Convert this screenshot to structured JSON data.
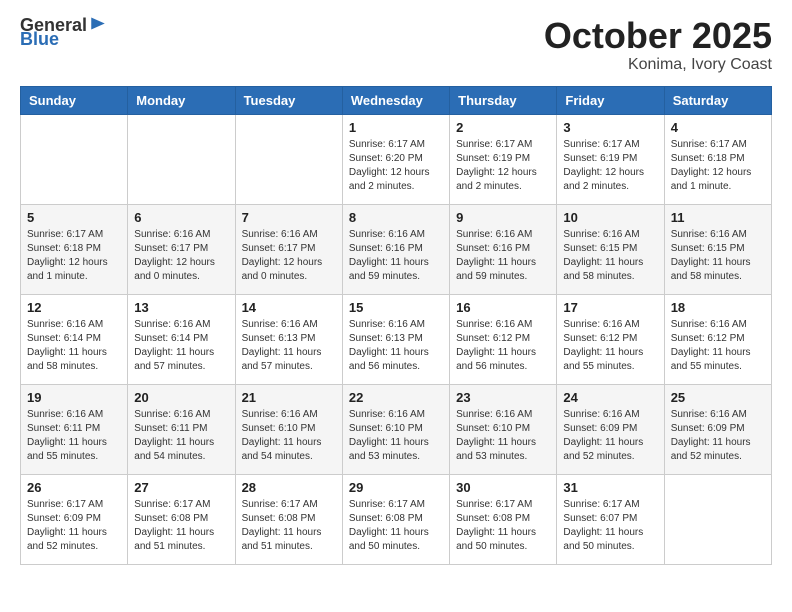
{
  "header": {
    "logo_general": "General",
    "logo_blue": "Blue",
    "month_title": "October 2025",
    "location": "Konima, Ivory Coast"
  },
  "weekdays": [
    "Sunday",
    "Monday",
    "Tuesday",
    "Wednesday",
    "Thursday",
    "Friday",
    "Saturday"
  ],
  "weeks": [
    [
      {
        "day": "",
        "sunrise": "",
        "sunset": "",
        "daylight": ""
      },
      {
        "day": "",
        "sunrise": "",
        "sunset": "",
        "daylight": ""
      },
      {
        "day": "",
        "sunrise": "",
        "sunset": "",
        "daylight": ""
      },
      {
        "day": "1",
        "sunrise": "Sunrise: 6:17 AM",
        "sunset": "Sunset: 6:20 PM",
        "daylight": "Daylight: 12 hours and 2 minutes."
      },
      {
        "day": "2",
        "sunrise": "Sunrise: 6:17 AM",
        "sunset": "Sunset: 6:19 PM",
        "daylight": "Daylight: 12 hours and 2 minutes."
      },
      {
        "day": "3",
        "sunrise": "Sunrise: 6:17 AM",
        "sunset": "Sunset: 6:19 PM",
        "daylight": "Daylight: 12 hours and 2 minutes."
      },
      {
        "day": "4",
        "sunrise": "Sunrise: 6:17 AM",
        "sunset": "Sunset: 6:18 PM",
        "daylight": "Daylight: 12 hours and 1 minute."
      }
    ],
    [
      {
        "day": "5",
        "sunrise": "Sunrise: 6:17 AM",
        "sunset": "Sunset: 6:18 PM",
        "daylight": "Daylight: 12 hours and 1 minute."
      },
      {
        "day": "6",
        "sunrise": "Sunrise: 6:16 AM",
        "sunset": "Sunset: 6:17 PM",
        "daylight": "Daylight: 12 hours and 0 minutes."
      },
      {
        "day": "7",
        "sunrise": "Sunrise: 6:16 AM",
        "sunset": "Sunset: 6:17 PM",
        "daylight": "Daylight: 12 hours and 0 minutes."
      },
      {
        "day": "8",
        "sunrise": "Sunrise: 6:16 AM",
        "sunset": "Sunset: 6:16 PM",
        "daylight": "Daylight: 11 hours and 59 minutes."
      },
      {
        "day": "9",
        "sunrise": "Sunrise: 6:16 AM",
        "sunset": "Sunset: 6:16 PM",
        "daylight": "Daylight: 11 hours and 59 minutes."
      },
      {
        "day": "10",
        "sunrise": "Sunrise: 6:16 AM",
        "sunset": "Sunset: 6:15 PM",
        "daylight": "Daylight: 11 hours and 58 minutes."
      },
      {
        "day": "11",
        "sunrise": "Sunrise: 6:16 AM",
        "sunset": "Sunset: 6:15 PM",
        "daylight": "Daylight: 11 hours and 58 minutes."
      }
    ],
    [
      {
        "day": "12",
        "sunrise": "Sunrise: 6:16 AM",
        "sunset": "Sunset: 6:14 PM",
        "daylight": "Daylight: 11 hours and 58 minutes."
      },
      {
        "day": "13",
        "sunrise": "Sunrise: 6:16 AM",
        "sunset": "Sunset: 6:14 PM",
        "daylight": "Daylight: 11 hours and 57 minutes."
      },
      {
        "day": "14",
        "sunrise": "Sunrise: 6:16 AM",
        "sunset": "Sunset: 6:13 PM",
        "daylight": "Daylight: 11 hours and 57 minutes."
      },
      {
        "day": "15",
        "sunrise": "Sunrise: 6:16 AM",
        "sunset": "Sunset: 6:13 PM",
        "daylight": "Daylight: 11 hours and 56 minutes."
      },
      {
        "day": "16",
        "sunrise": "Sunrise: 6:16 AM",
        "sunset": "Sunset: 6:12 PM",
        "daylight": "Daylight: 11 hours and 56 minutes."
      },
      {
        "day": "17",
        "sunrise": "Sunrise: 6:16 AM",
        "sunset": "Sunset: 6:12 PM",
        "daylight": "Daylight: 11 hours and 55 minutes."
      },
      {
        "day": "18",
        "sunrise": "Sunrise: 6:16 AM",
        "sunset": "Sunset: 6:12 PM",
        "daylight": "Daylight: 11 hours and 55 minutes."
      }
    ],
    [
      {
        "day": "19",
        "sunrise": "Sunrise: 6:16 AM",
        "sunset": "Sunset: 6:11 PM",
        "daylight": "Daylight: 11 hours and 55 minutes."
      },
      {
        "day": "20",
        "sunrise": "Sunrise: 6:16 AM",
        "sunset": "Sunset: 6:11 PM",
        "daylight": "Daylight: 11 hours and 54 minutes."
      },
      {
        "day": "21",
        "sunrise": "Sunrise: 6:16 AM",
        "sunset": "Sunset: 6:10 PM",
        "daylight": "Daylight: 11 hours and 54 minutes."
      },
      {
        "day": "22",
        "sunrise": "Sunrise: 6:16 AM",
        "sunset": "Sunset: 6:10 PM",
        "daylight": "Daylight: 11 hours and 53 minutes."
      },
      {
        "day": "23",
        "sunrise": "Sunrise: 6:16 AM",
        "sunset": "Sunset: 6:10 PM",
        "daylight": "Daylight: 11 hours and 53 minutes."
      },
      {
        "day": "24",
        "sunrise": "Sunrise: 6:16 AM",
        "sunset": "Sunset: 6:09 PM",
        "daylight": "Daylight: 11 hours and 52 minutes."
      },
      {
        "day": "25",
        "sunrise": "Sunrise: 6:16 AM",
        "sunset": "Sunset: 6:09 PM",
        "daylight": "Daylight: 11 hours and 52 minutes."
      }
    ],
    [
      {
        "day": "26",
        "sunrise": "Sunrise: 6:17 AM",
        "sunset": "Sunset: 6:09 PM",
        "daylight": "Daylight: 11 hours and 52 minutes."
      },
      {
        "day": "27",
        "sunrise": "Sunrise: 6:17 AM",
        "sunset": "Sunset: 6:08 PM",
        "daylight": "Daylight: 11 hours and 51 minutes."
      },
      {
        "day": "28",
        "sunrise": "Sunrise: 6:17 AM",
        "sunset": "Sunset: 6:08 PM",
        "daylight": "Daylight: 11 hours and 51 minutes."
      },
      {
        "day": "29",
        "sunrise": "Sunrise: 6:17 AM",
        "sunset": "Sunset: 6:08 PM",
        "daylight": "Daylight: 11 hours and 50 minutes."
      },
      {
        "day": "30",
        "sunrise": "Sunrise: 6:17 AM",
        "sunset": "Sunset: 6:08 PM",
        "daylight": "Daylight: 11 hours and 50 minutes."
      },
      {
        "day": "31",
        "sunrise": "Sunrise: 6:17 AM",
        "sunset": "Sunset: 6:07 PM",
        "daylight": "Daylight: 11 hours and 50 minutes."
      },
      {
        "day": "",
        "sunrise": "",
        "sunset": "",
        "daylight": ""
      }
    ]
  ]
}
